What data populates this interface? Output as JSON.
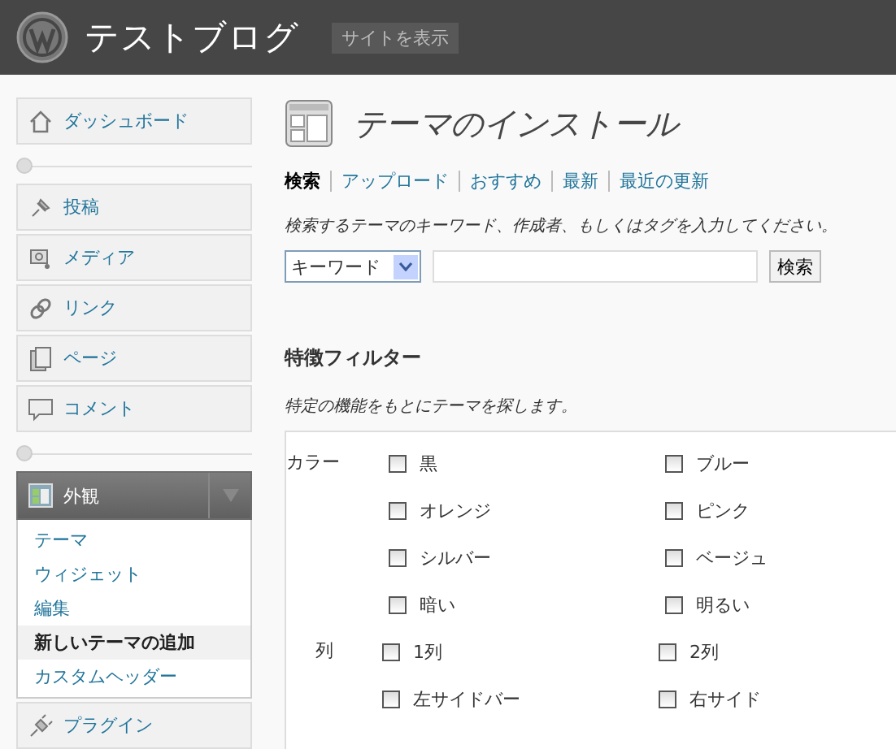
{
  "header": {
    "site_title": "テストブログ",
    "view_site": "サイトを表示"
  },
  "sidebar": {
    "groups": [
      [
        {
          "label": "ダッシュボード",
          "expanded": false
        }
      ],
      [
        {
          "label": "投稿",
          "expanded": false
        },
        {
          "label": "メディア",
          "expanded": false
        },
        {
          "label": "リンク",
          "expanded": false
        },
        {
          "label": "ページ",
          "expanded": false
        },
        {
          "label": "コメント",
          "expanded": false
        }
      ],
      [
        {
          "label": "外観",
          "expanded": true,
          "children": [
            {
              "label": "テーマ",
              "selected": false
            },
            {
              "label": "ウィジェット",
              "selected": false
            },
            {
              "label": "編集",
              "selected": false
            },
            {
              "label": "新しいテーマの追加",
              "selected": true
            },
            {
              "label": "カスタムヘッダー",
              "selected": false
            }
          ]
        },
        {
          "label": "プラグイン",
          "expanded": false
        }
      ]
    ]
  },
  "page": {
    "title": "テーマのインストール",
    "tabs": [
      {
        "label": "検索",
        "selected": true
      },
      {
        "label": "アップロード",
        "selected": false
      },
      {
        "label": "おすすめ",
        "selected": false
      },
      {
        "label": "最新",
        "selected": false
      },
      {
        "label": "最近の更新",
        "selected": false
      }
    ],
    "search_hint": "検索するテーマのキーワード、作成者、もしくはタグを入力してください。",
    "search_type": "キーワード",
    "search_button": "検索",
    "filter_title": "特徴フィルター",
    "filter_description": "特定の機能をもとにテーマを探します。",
    "filters": [
      {
        "label": "カラー",
        "options": [
          {
            "label": "黒",
            "checked": false
          },
          {
            "label": "ブルー",
            "checked": false
          },
          {
            "label": "オレンジ",
            "checked": false
          },
          {
            "label": "ピンク",
            "checked": false
          },
          {
            "label": "シルバー",
            "checked": false
          },
          {
            "label": "ベージュ",
            "checked": false
          },
          {
            "label": "暗い",
            "checked": false
          },
          {
            "label": "明るい",
            "checked": false
          }
        ]
      },
      {
        "label": "列",
        "options": [
          {
            "label": "1列",
            "checked": false
          },
          {
            "label": "2列",
            "checked": false
          },
          {
            "label": "左サイドバー",
            "checked": false
          },
          {
            "label": "右サイド",
            "checked": false
          }
        ]
      }
    ]
  }
}
